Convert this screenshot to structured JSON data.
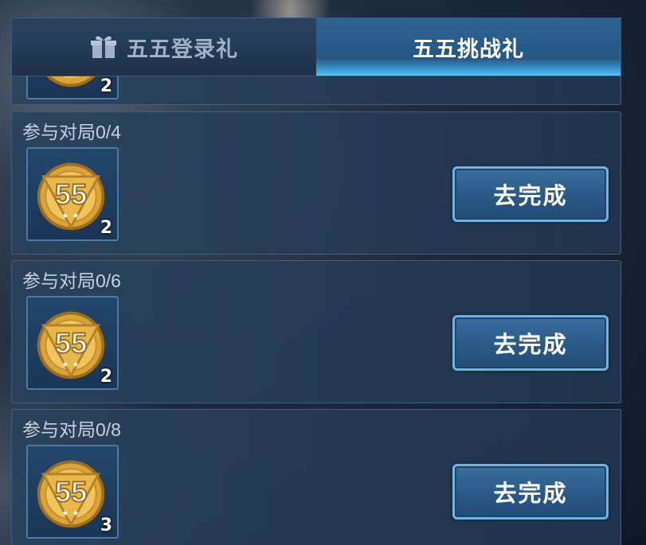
{
  "tabs": [
    {
      "label": "五五登录礼",
      "icon": "gift-icon",
      "active": false
    },
    {
      "label": "五五挑战礼",
      "active": true
    }
  ],
  "partial_reward": {
    "count": "2"
  },
  "tasks": [
    {
      "label": "参与对局0/4",
      "reward_icon": "55-coin-icon",
      "reward_count": "2",
      "button": "去完成"
    },
    {
      "label": "参与对局0/6",
      "reward_icon": "55-coin-icon",
      "reward_count": "2",
      "button": "去完成"
    },
    {
      "label": "参与对局0/8",
      "reward_icon": "55-coin-icon",
      "reward_count": "3",
      "button": "去完成"
    }
  ],
  "colors": {
    "active_tab": "#2e6390",
    "accent": "#5cc4f5",
    "coin_gold": "#e8b84a"
  }
}
